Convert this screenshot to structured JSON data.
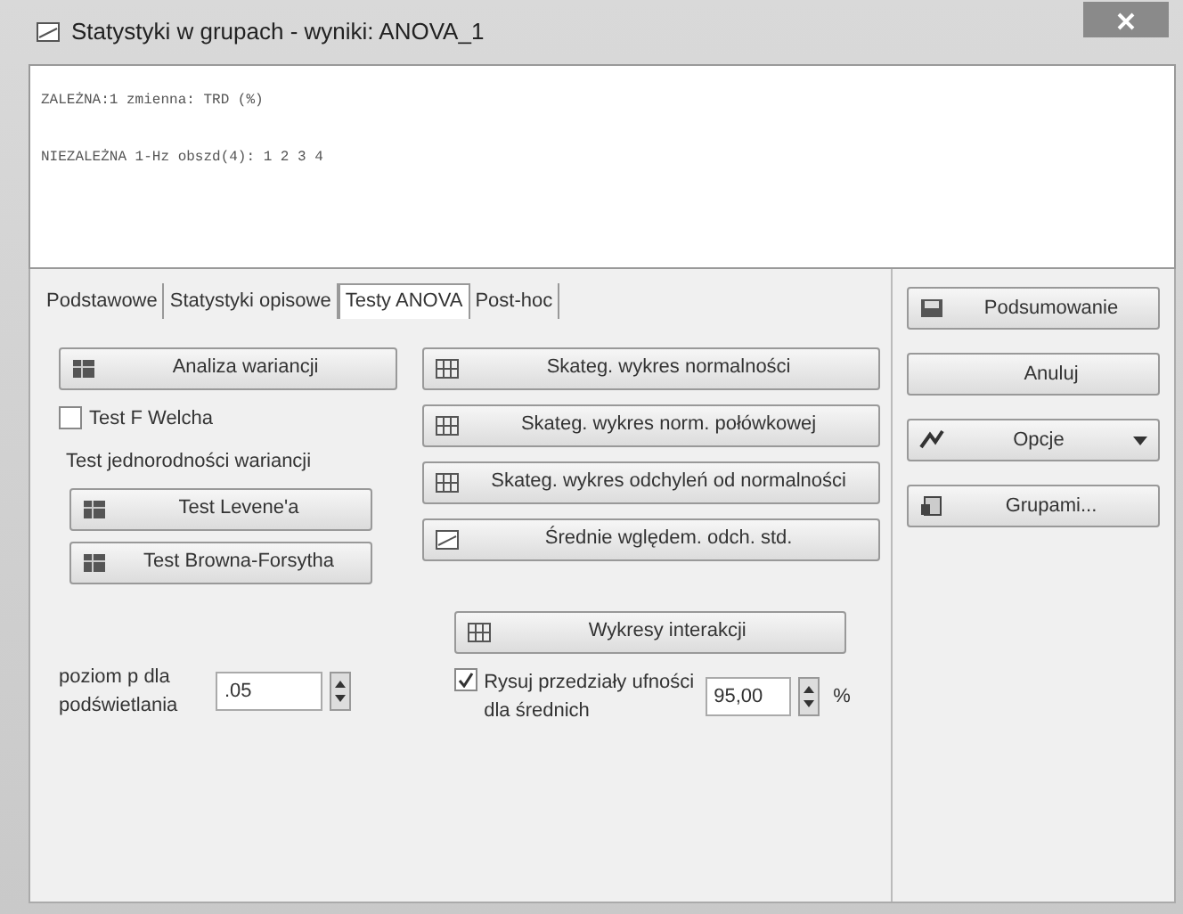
{
  "window": {
    "title": "Statystyki w grupach - wyniki: ANOVA_1"
  },
  "output": {
    "lines": [
      "ZALEŻNA:1 zmienna: TRD (%)",
      "NIEZALEŻNA 1-Hz obszd(4): 1 2 3 4"
    ]
  },
  "tabs": [
    {
      "label": "Podstawowe",
      "selected": false
    },
    {
      "label": "Statystyki opisowe",
      "selected": false
    },
    {
      "label": "Testy ANOVA",
      "selected": true
    },
    {
      "label": "Post-hoc",
      "selected": false
    }
  ],
  "left": {
    "analysis_button": "Analiza wariancji",
    "welch": {
      "label": "Test F Welcha",
      "checked": false
    },
    "homogeneity_label": "Test jednorodności wariancji",
    "homogeneity_buttons": [
      "Test Levene'a",
      "Test Browna-Forsytha"
    ],
    "p_level": {
      "label": "poziom p dla podświetlania",
      "value": ".05"
    }
  },
  "right": {
    "plot_buttons": [
      {
        "label": "Skateg. wykres normalności",
        "kind": "grid"
      },
      {
        "label": "Skateg. wykres norm. połówkowej",
        "kind": "grid"
      },
      {
        "label": "Skateg. wykres odchyleń od normalności",
        "kind": "grid"
      },
      {
        "label": "Średnie wględem. odch. std.",
        "kind": "window"
      }
    ],
    "interaction_button": "Wykresy interakcji",
    "intervals": {
      "label": "Rysuj przedziały ufności dla średnich",
      "checked": true,
      "value": "95,00",
      "unit": "%"
    }
  },
  "side_buttons": [
    {
      "label": "Podsumowanie",
      "kind": "save"
    },
    {
      "label": "Anuluj",
      "kind": "plain"
    },
    {
      "label": "Opcje",
      "kind": "options"
    },
    {
      "label": "Grupami...",
      "kind": "group"
    }
  ]
}
